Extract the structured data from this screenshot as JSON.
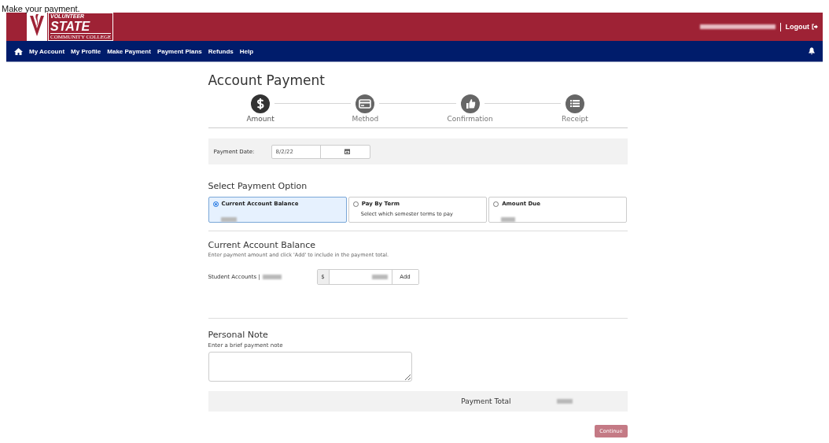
{
  "caption": "Make your payment.",
  "logo": {
    "line_1": "VOLUNTEER",
    "line_2": "STATE",
    "line_3": "COMMUNITY COLLEGE"
  },
  "header": {
    "logout": "Logout"
  },
  "nav": {
    "items": [
      {
        "label": "My Account"
      },
      {
        "label": "My Profile"
      },
      {
        "label": "Make Payment"
      },
      {
        "label": "Payment Plans"
      },
      {
        "label": "Refunds"
      },
      {
        "label": "Help"
      }
    ]
  },
  "page_title": "Account Payment",
  "steps": [
    {
      "label": "Amount",
      "selected": true
    },
    {
      "label": "Method",
      "selected": false
    },
    {
      "label": "Confirmation",
      "selected": false
    },
    {
      "label": "Receipt",
      "selected": false
    }
  ],
  "payment_date": {
    "label": "Payment Date:",
    "value": "8/2/22"
  },
  "options_heading": "Select Payment Option",
  "options": [
    {
      "title": "Current Account Balance",
      "selected": true
    },
    {
      "title": "Pay By Term",
      "detail": "Select which semester terms to pay",
      "selected": false
    },
    {
      "title": "Amount Due",
      "selected": false
    }
  ],
  "balance": {
    "heading": "Current Account Balance",
    "hint": "Enter payment amount and click 'Add' to include in the payment total.",
    "account_label": "Student Accounts |",
    "currency": "$",
    "add_button": "Add"
  },
  "note": {
    "heading": "Personal Note",
    "hint": "Enter a brief payment note"
  },
  "total": {
    "label": "Payment Total"
  },
  "continue": {
    "label": "Continue",
    "disabled": true
  }
}
